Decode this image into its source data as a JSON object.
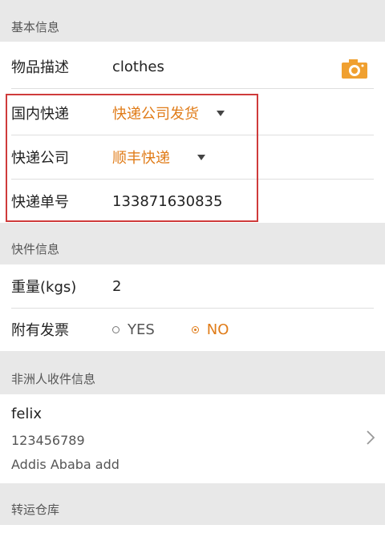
{
  "sections": {
    "basic_info": "基本信息",
    "package_info": "快件信息",
    "recipient_info": "非洲人收件信息",
    "warehouse": "转运仓库"
  },
  "basic": {
    "item_desc_label": "物品描述",
    "item_desc_value": "clothes",
    "domestic_express_label": "国内快递",
    "domestic_express_value": "快递公司发货",
    "courier_label": "快递公司",
    "courier_value": "顺丰快递",
    "tracking_label": "快递单号",
    "tracking_value": "133871630835"
  },
  "package": {
    "weight_label": "重量(kgs)",
    "weight_value": "2",
    "invoice_label": "附有发票",
    "invoice_options": [
      "YES",
      "NO"
    ],
    "invoice_selected": "NO"
  },
  "recipient": {
    "name": "felix",
    "phone": "123456789",
    "address": "Addis Ababa add"
  },
  "colors": {
    "accent": "#e07c19",
    "highlight_box": "#cf3b3b"
  },
  "icons": {
    "camera": "camera-icon",
    "chevron": "chevron-right-icon"
  }
}
